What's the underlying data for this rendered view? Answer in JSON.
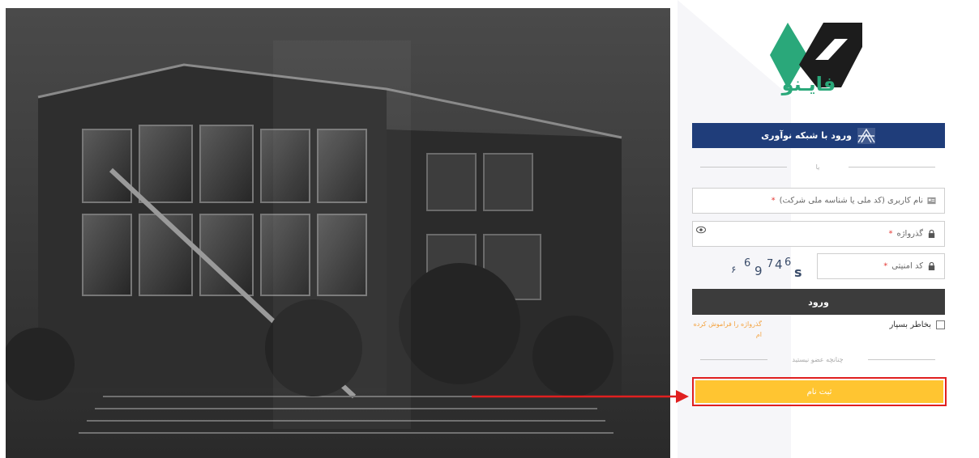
{
  "brand": {
    "name": "فایـنو",
    "logo_colors": {
      "green": "#2aa87a",
      "dark": "#1c1c1c"
    }
  },
  "sso": {
    "label": "ورود با شبکه نوآوری",
    "color": "#1f3d7a"
  },
  "divider_or": "یا",
  "form": {
    "username_placeholder": "نام کاربری (کد ملی یا شناسه ملی شرکت)",
    "password_placeholder": "گذرواژه",
    "code_placeholder": "کد امنیتی",
    "required_mark": "*",
    "captcha_chars": [
      "۶",
      "6",
      "9",
      "7",
      "4",
      "6",
      "s"
    ],
    "login_label": "ورود",
    "remember_label": "بخاطر بسپار",
    "forgot_label": "گذرواژه را فراموش کرده ام"
  },
  "divider_notmember": "چنانچه عضو نیستید",
  "signup": {
    "label": "ثبت نام",
    "color": "#ffc531",
    "highlight_color": "#e02020"
  }
}
